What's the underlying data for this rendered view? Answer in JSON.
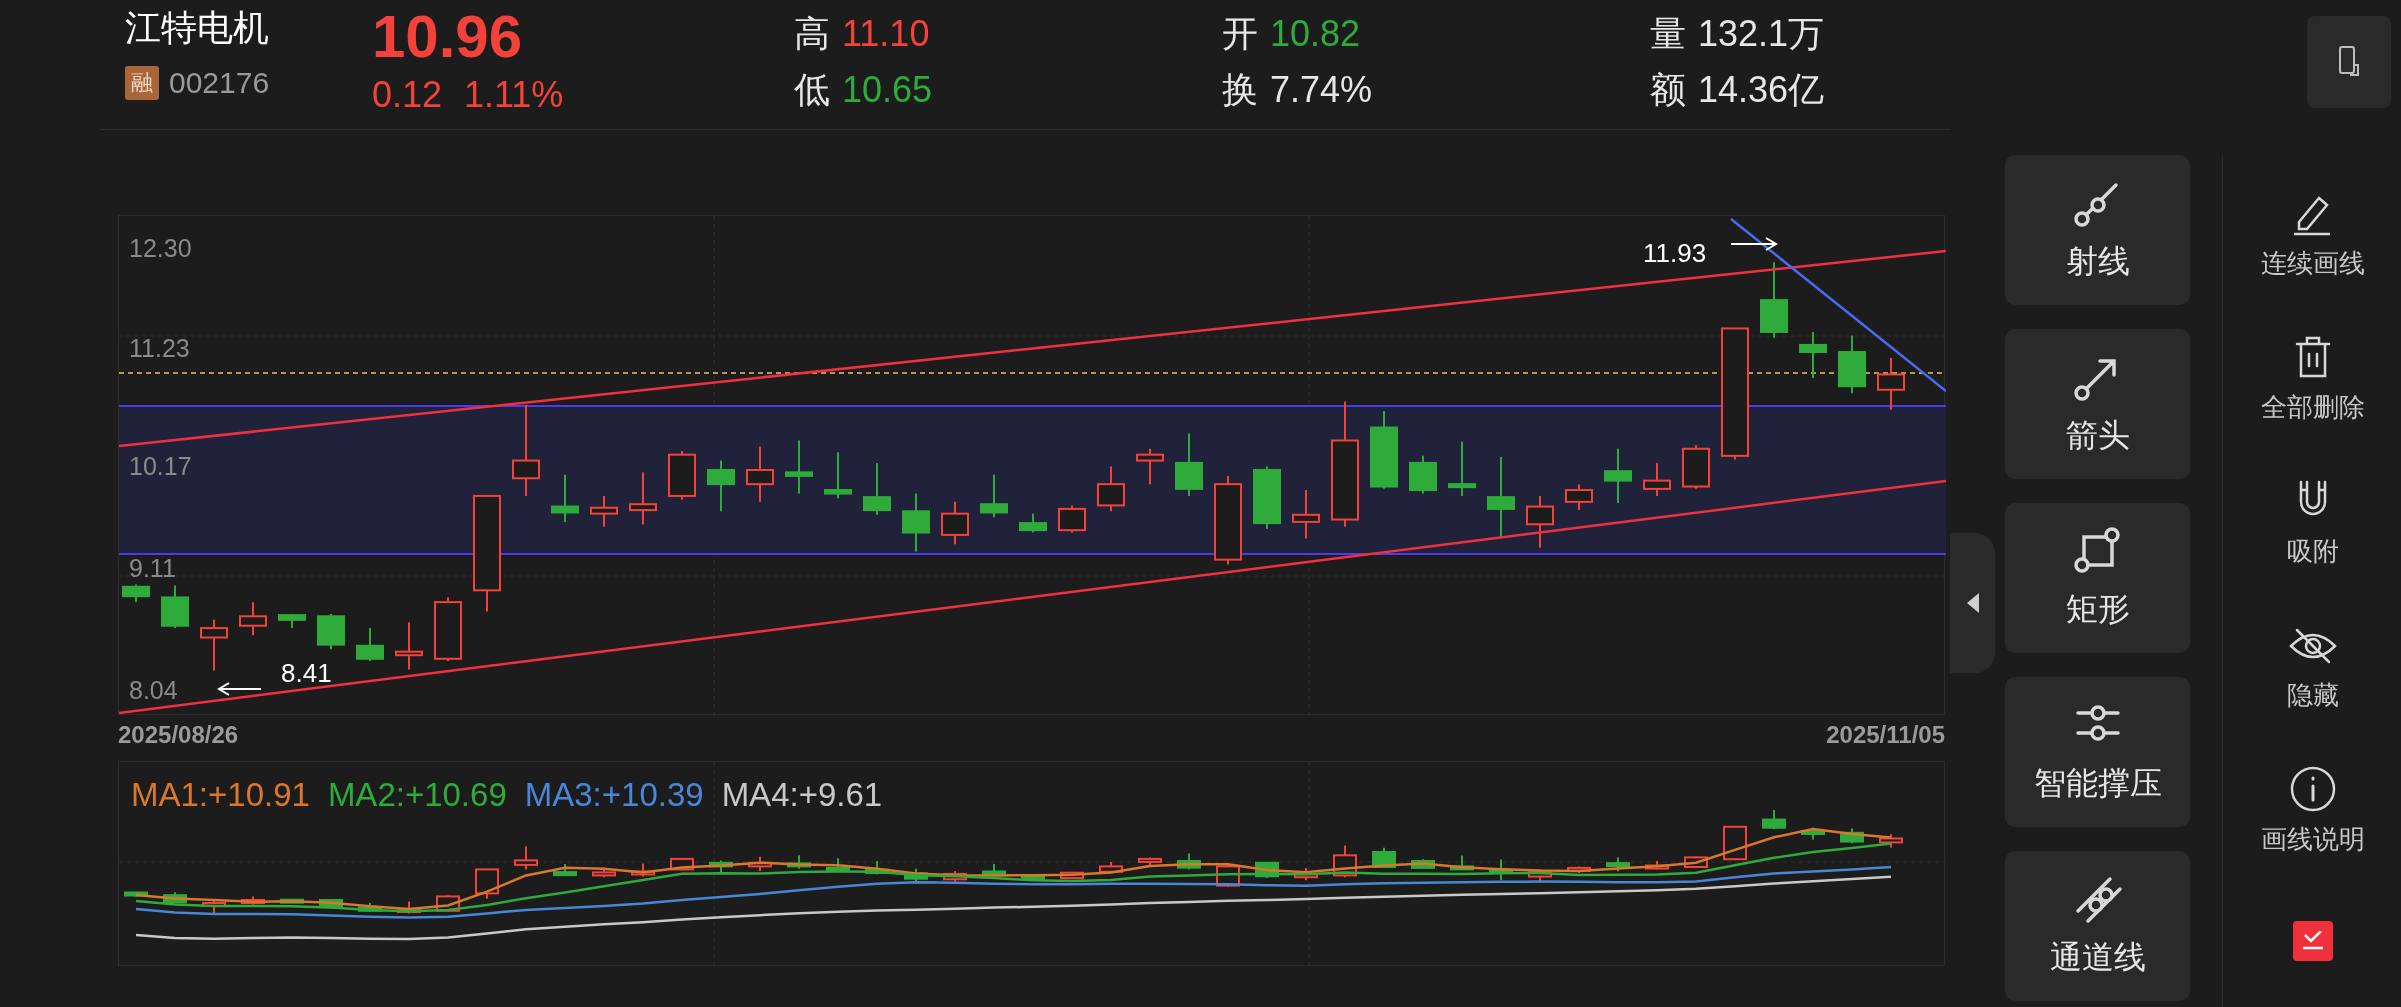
{
  "stock": {
    "name": "江特电机",
    "badge": "融",
    "code": "002176",
    "price": "10.96",
    "change": "0.12",
    "change_pct": "1.11%"
  },
  "stats": [
    {
      "label": "高",
      "value": "11.10",
      "color": "#f2423a"
    },
    {
      "label": "低",
      "value": "10.65",
      "color": "#2eab3a"
    },
    {
      "label": "开",
      "value": "10.82",
      "color": "#2eab3a"
    },
    {
      "label": "换",
      "value": "7.74%",
      "color": "#e6e6e6"
    },
    {
      "label": "量",
      "value": "132.1万",
      "color": "#e6e6e6"
    },
    {
      "label": "额",
      "value": "14.36亿",
      "color": "#e6e6e6"
    }
  ],
  "chart": {
    "y_ticks": [
      "12.30",
      "11.23",
      "10.17",
      "9.11",
      "8.04"
    ],
    "start_date": "2025/08/26",
    "end_date": "2025/11/05",
    "high_mark": "11.93",
    "low_mark": "8.41"
  },
  "ma_legend": [
    {
      "label": "MA1:+10.91",
      "color": "#d9782d"
    },
    {
      "label": "MA2:+10.69",
      "color": "#2eab3a"
    },
    {
      "label": "MA3:+10.39",
      "color": "#4a86d8"
    },
    {
      "label": "MA4:+9.61",
      "color": "#c8c8c8"
    }
  ],
  "tools": [
    {
      "label": "射线",
      "kind": "ray"
    },
    {
      "label": "箭头",
      "kind": "arrow"
    },
    {
      "label": "矩形",
      "kind": "rect"
    },
    {
      "label": "智能撑压",
      "kind": "levels"
    },
    {
      "label": "通道线",
      "kind": "channel"
    }
  ],
  "side_actions": [
    {
      "label": "连续画线",
      "kind": "pen"
    },
    {
      "label": "全部删除",
      "kind": "trash"
    },
    {
      "label": "吸附",
      "kind": "magnet"
    },
    {
      "label": "隐藏",
      "kind": "hide"
    },
    {
      "label": "画线说明",
      "kind": "info"
    }
  ]
}
